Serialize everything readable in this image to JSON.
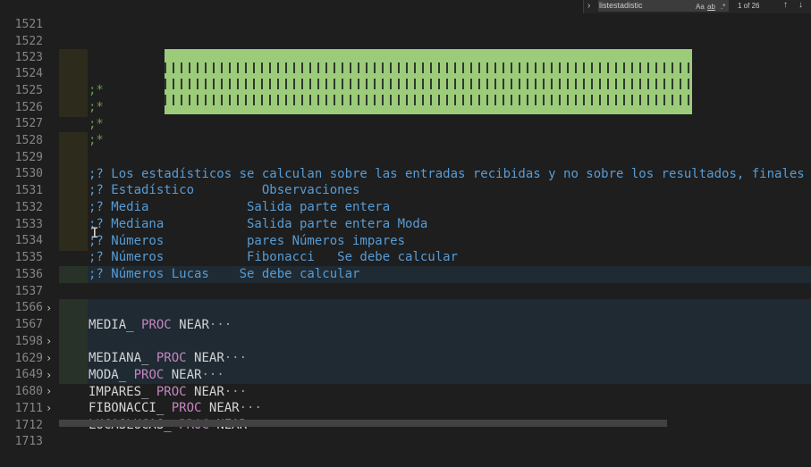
{
  "find_widget": {
    "query": "listestadistic",
    "match_case": "Aa",
    "whole_word": "ab",
    "regex": ".*",
    "result_count": "1 of 26",
    "up_arrow": "↑",
    "down_arrow": "↓",
    "expand": "›"
  },
  "fold_marker": "›",
  "ellipsis": "···",
  "colors": {
    "comment_green": "#6a9955",
    "comment_blue": "#569cd6",
    "keyword": "#c586c0",
    "banner": "#9ccc7a"
  },
  "lines": [
    {
      "num": "1521",
      "text": ""
    },
    {
      "num": "1522",
      "text": ""
    },
    {
      "num": "1523",
      "text": ""
    },
    {
      "num": "1524",
      "text": ";*"
    },
    {
      "num": "1525",
      "text": ";*"
    },
    {
      "num": "1526",
      "text": ";*"
    },
    {
      "num": "1527",
      "text": ";*"
    },
    {
      "num": "1528",
      "text": ""
    },
    {
      "num": "1529",
      "text": ";? Los estadísticos se calculan sobre las entradas recibidas y no sobre los resultados, finales"
    },
    {
      "num": "1530",
      "text": ";? Estadístico         Observaciones"
    },
    {
      "num": "1531",
      "text": ";? Media             Salida parte entera"
    },
    {
      "num": "1532",
      "text": ";? Mediana           Salida parte entera Moda"
    },
    {
      "num": "1533",
      "text": ";? Números           pares Números impares"
    },
    {
      "num": "1534",
      "text": ";? Números           Fibonacci   Se debe calcular"
    },
    {
      "num": "1535",
      "text": ";? Números Lucas    Se debe calcular"
    },
    {
      "num": "1536",
      "text": ""
    },
    {
      "num": "1537",
      "name": "MEDIA_",
      "kw": "PROC",
      "rest": "NEAR"
    },
    {
      "num": "1566",
      "text": ""
    },
    {
      "num": "1567",
      "name": "MEDIANA_",
      "kw": "PROC",
      "rest": "NEAR"
    },
    {
      "num": "1598",
      "name": "MODA_",
      "kw": "PROC",
      "rest": "NEAR"
    },
    {
      "num": "1629",
      "name": "IMPARES_",
      "kw": "PROC",
      "rest": "NEAR"
    },
    {
      "num": "1649",
      "name": "FIBONACCI_",
      "kw": "PROC",
      "rest": "NEAR"
    },
    {
      "num": "1680",
      "name": "LUCASLUCAS_",
      "kw": "PROC",
      "rest": "NEAR"
    },
    {
      "num": "1711",
      "text": ""
    },
    {
      "num": "1712",
      "text": ""
    },
    {
      "num": "1713",
      "text": ""
    }
  ]
}
